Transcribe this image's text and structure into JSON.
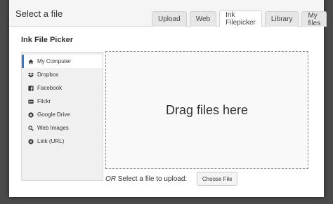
{
  "modal": {
    "title": "Select a file",
    "tabs": [
      {
        "label": "Upload",
        "active": false
      },
      {
        "label": "Web",
        "active": false
      },
      {
        "label": "Ink Filepicker",
        "active": true
      },
      {
        "label": "Library",
        "active": false
      },
      {
        "label": "My files",
        "active": false
      }
    ]
  },
  "picker": {
    "title": "Ink File Picker",
    "sources": [
      {
        "label": "My Computer",
        "icon": "home-icon",
        "active": true
      },
      {
        "label": "Dropbox",
        "icon": "dropbox-icon",
        "active": false
      },
      {
        "label": "Facebook",
        "icon": "facebook-icon",
        "active": false
      },
      {
        "label": "Flickr",
        "icon": "flickr-icon",
        "active": false
      },
      {
        "label": "Google Drive",
        "icon": "google-drive-icon",
        "active": false
      },
      {
        "label": "Web Images",
        "icon": "search-icon",
        "active": false
      },
      {
        "label": "Link (URL)",
        "icon": "link-icon",
        "active": false
      }
    ]
  },
  "dropzone": {
    "text": "Drag files here"
  },
  "upload": {
    "or_label": "OR",
    "text": " Select a file to upload:",
    "button_label": "Choose File"
  },
  "colors": {
    "accent": "#2f7bd4",
    "backdrop": "#4a4a4a"
  }
}
